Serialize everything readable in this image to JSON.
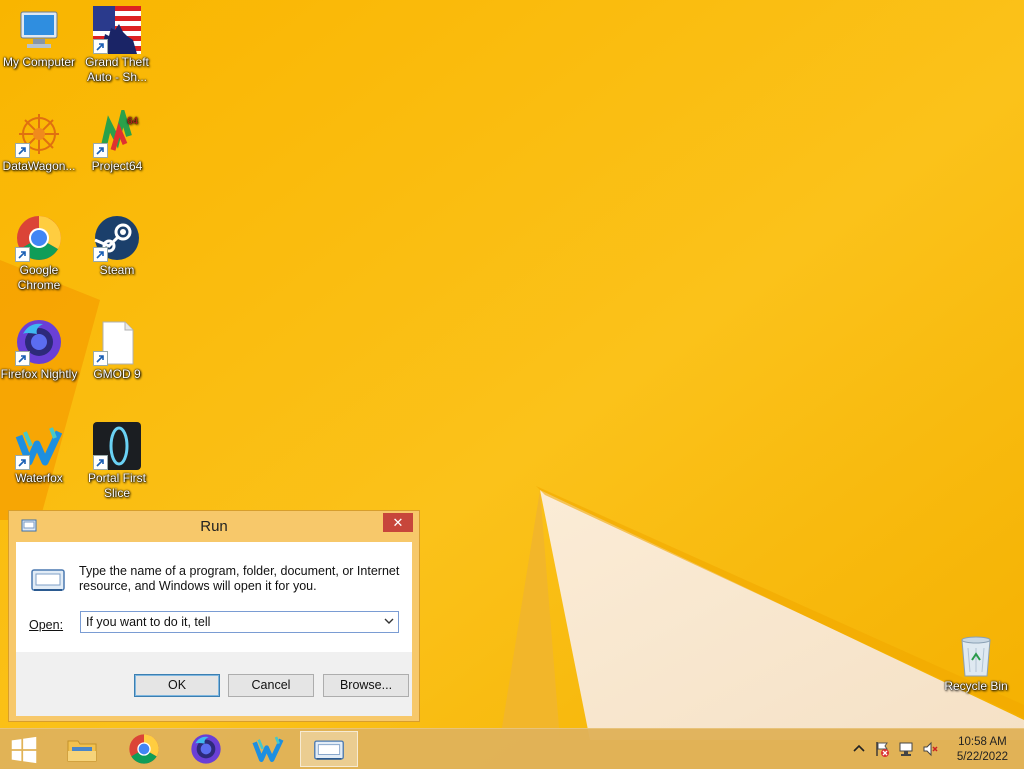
{
  "desktop": {
    "icons": [
      {
        "label": "My Computer",
        "icon": "computer-icon"
      },
      {
        "label": "Grand Theft Auto - Sh...",
        "icon": "gta-flag-icon"
      },
      {
        "label": "DataWagon...",
        "icon": "datawagon-icon"
      },
      {
        "label": "Project64",
        "icon": "project64-icon"
      },
      {
        "label": "Google Chrome",
        "icon": "chrome-icon"
      },
      {
        "label": "Steam",
        "icon": "steam-icon"
      },
      {
        "label": "Firefox Nightly",
        "icon": "firefox-nightly-icon"
      },
      {
        "label": "GMOD 9",
        "icon": "blank-file-icon"
      },
      {
        "label": "Waterfox",
        "icon": "waterfox-icon"
      },
      {
        "label": "Portal First Slice",
        "icon": "portal-icon"
      },
      {
        "label": "Recycle Bin",
        "icon": "recycle-bin-icon"
      }
    ]
  },
  "run_dialog": {
    "title": "Run",
    "close_glyph": "✕",
    "description": "Type the name of a program, folder, document, or Internet resource, and Windows will open it for you.",
    "open_label": "Open:",
    "open_value": "If you want to do it, tell ",
    "ok_label": "OK",
    "cancel_label": "Cancel",
    "browse_label": "Browse..."
  },
  "taskbar": {
    "items": [
      "start-button",
      "file-explorer",
      "google-chrome",
      "firefox-nightly",
      "waterfox",
      "run"
    ],
    "time": "10:58 AM",
    "date": "5/22/2022"
  },
  "colors": {
    "wallpaper": "#f5b400",
    "dialog_frame": "#f7c86a",
    "close_button": "#c7463b",
    "taskbar": "#e0b25a"
  }
}
